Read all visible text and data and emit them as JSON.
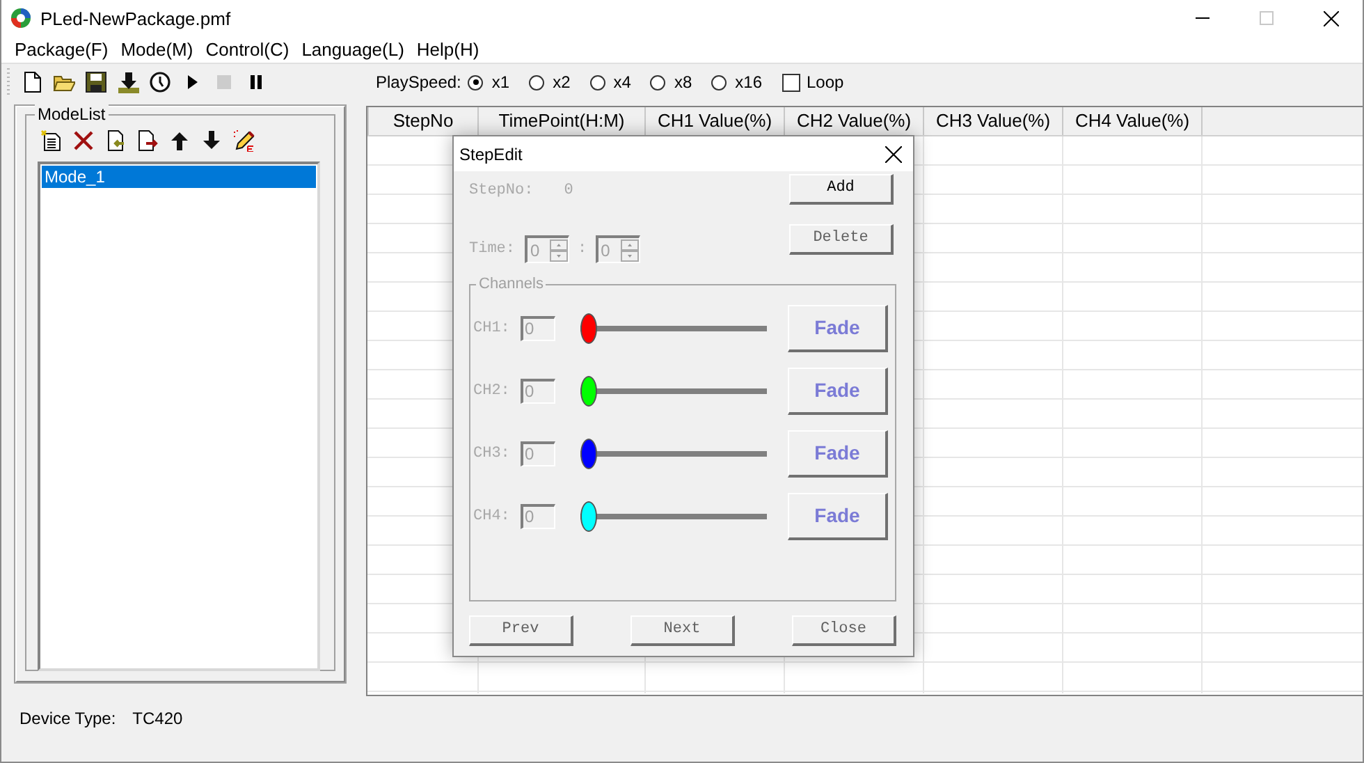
{
  "window": {
    "title": "PLed-NewPackage.pmf"
  },
  "menu": [
    "Package(F)",
    "Mode(M)",
    "Control(C)",
    "Language(L)",
    "Help(H)"
  ],
  "toolbar": [
    {
      "kind": "new",
      "disabled": false
    },
    {
      "kind": "open",
      "disabled": false
    },
    {
      "kind": "save",
      "disabled": false
    },
    {
      "kind": "download",
      "disabled": false
    },
    {
      "kind": "clock",
      "disabled": false
    },
    {
      "kind": "play",
      "disabled": false
    },
    {
      "kind": "stop",
      "disabled": true
    },
    {
      "kind": "pause",
      "disabled": false
    }
  ],
  "play_speed": {
    "label": "PlaySpeed:",
    "options": [
      {
        "label": "x1",
        "selected": true
      },
      {
        "label": "x2",
        "selected": false
      },
      {
        "label": "x4",
        "selected": false
      },
      {
        "label": "x8",
        "selected": false
      },
      {
        "label": "x16",
        "selected": false
      }
    ],
    "loop": {
      "label": "Loop",
      "checked": false
    }
  },
  "mode_list": {
    "title": "ModeList",
    "tools": [
      {
        "kind": "new"
      },
      {
        "kind": "delete"
      },
      {
        "kind": "import"
      },
      {
        "kind": "export"
      },
      {
        "kind": "up"
      },
      {
        "kind": "down"
      },
      {
        "kind": "edit"
      }
    ],
    "items": [
      {
        "label": "Mode_1",
        "selected": true
      }
    ]
  },
  "table": {
    "columns": [
      "StepNo",
      "TimePoint(H:M)",
      "CH1 Value(%)",
      "CH2 Value(%)",
      "CH3 Value(%)",
      "CH4 Value(%)"
    ]
  },
  "status_bar": {
    "label": "Device Type:",
    "value": "TC420"
  },
  "step_edit": {
    "title": "StepEdit",
    "inputs_disabled": true,
    "step_label": "StepNo:",
    "step_value": "0",
    "time_label": "Time:",
    "hours": "0",
    "separator": ":",
    "minutes": "0",
    "actions": [
      {
        "label": "Add",
        "disabled": false
      },
      {
        "label": "Delete",
        "disabled": true
      }
    ],
    "channels_title": "Channels",
    "channels": [
      {
        "label": "CH1:",
        "value": "0",
        "level": 0,
        "color": "#ff0000",
        "button": "Fade"
      },
      {
        "label": "CH2:",
        "value": "0",
        "level": 0,
        "color": "#00ff00",
        "button": "Fade"
      },
      {
        "label": "CH3:",
        "value": "0",
        "level": 0,
        "color": "#0000ff",
        "button": "Fade"
      },
      {
        "label": "CH4:",
        "value": "0",
        "level": 0,
        "color": "#00ffff",
        "button": "Fade"
      }
    ],
    "footer": [
      {
        "label": "Prev",
        "disabled": true
      },
      {
        "label": "Next",
        "disabled": true
      },
      {
        "label": "Close",
        "disabled": true
      }
    ]
  }
}
